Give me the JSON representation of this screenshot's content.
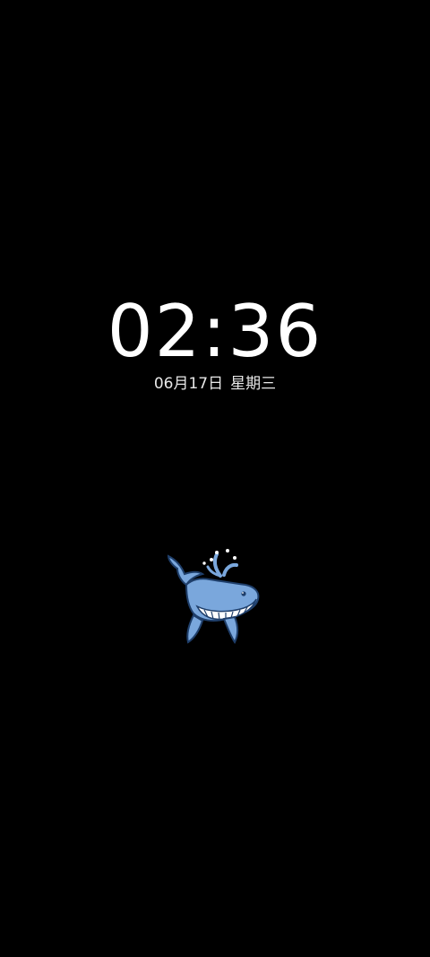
{
  "lockscreen": {
    "time": "02:36",
    "date": "06月17日",
    "weekday": "星期三",
    "art_icon": "whale-icon"
  },
  "colors": {
    "background": "#000000",
    "text": "#ffffff",
    "whale_body": "#7aa7dc",
    "whale_belly": "#ffffff",
    "whale_outline": "#1f3f6b"
  }
}
